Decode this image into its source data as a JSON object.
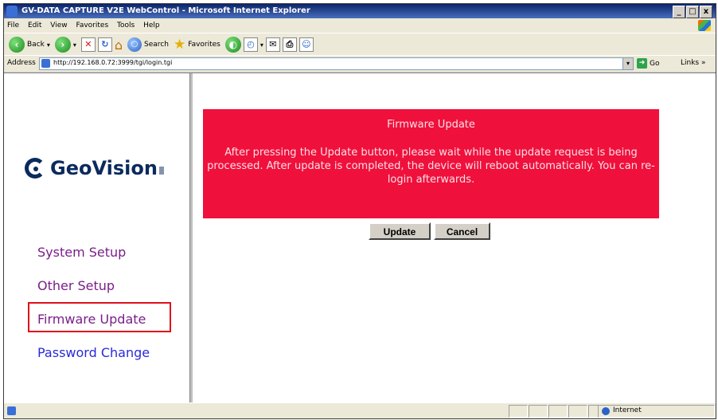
{
  "window": {
    "title": "GV-DATA CAPTURE V2E WebControl - Microsoft Internet Explorer",
    "controls": [
      "_",
      "□",
      "x"
    ]
  },
  "menubar": {
    "items": [
      "File",
      "Edit",
      "View",
      "Favorites",
      "Tools",
      "Help"
    ]
  },
  "toolbar": {
    "back_label": "Back",
    "search_label": "Search",
    "favorites_label": "Favorites"
  },
  "addressbar": {
    "label": "Address",
    "url": "http://192.168.0.72:3999/tgi/login.tgi",
    "go_label": "Go",
    "links_label": "Links »"
  },
  "sidebar": {
    "logo_text": "GeoVision",
    "items": [
      {
        "label": "System Setup",
        "color": "#7a1e8a"
      },
      {
        "label": "Other Setup",
        "color": "#7a1e8a"
      },
      {
        "label": "Firmware Update",
        "color": "#7a1e8a",
        "highlighted": true
      },
      {
        "label": "Password Change",
        "color": "#2a2ad8"
      }
    ]
  },
  "main": {
    "notice_title": "Firmware Update",
    "notice_message": "After pressing the Update button, please wait while the update request is being processed. After update is completed, the device will reboot automatically. You can re-login afterwards.",
    "notice_bg": "#f0103c",
    "update_button": "Update",
    "cancel_button": "Cancel"
  },
  "statusbar": {
    "zone": "Internet"
  }
}
